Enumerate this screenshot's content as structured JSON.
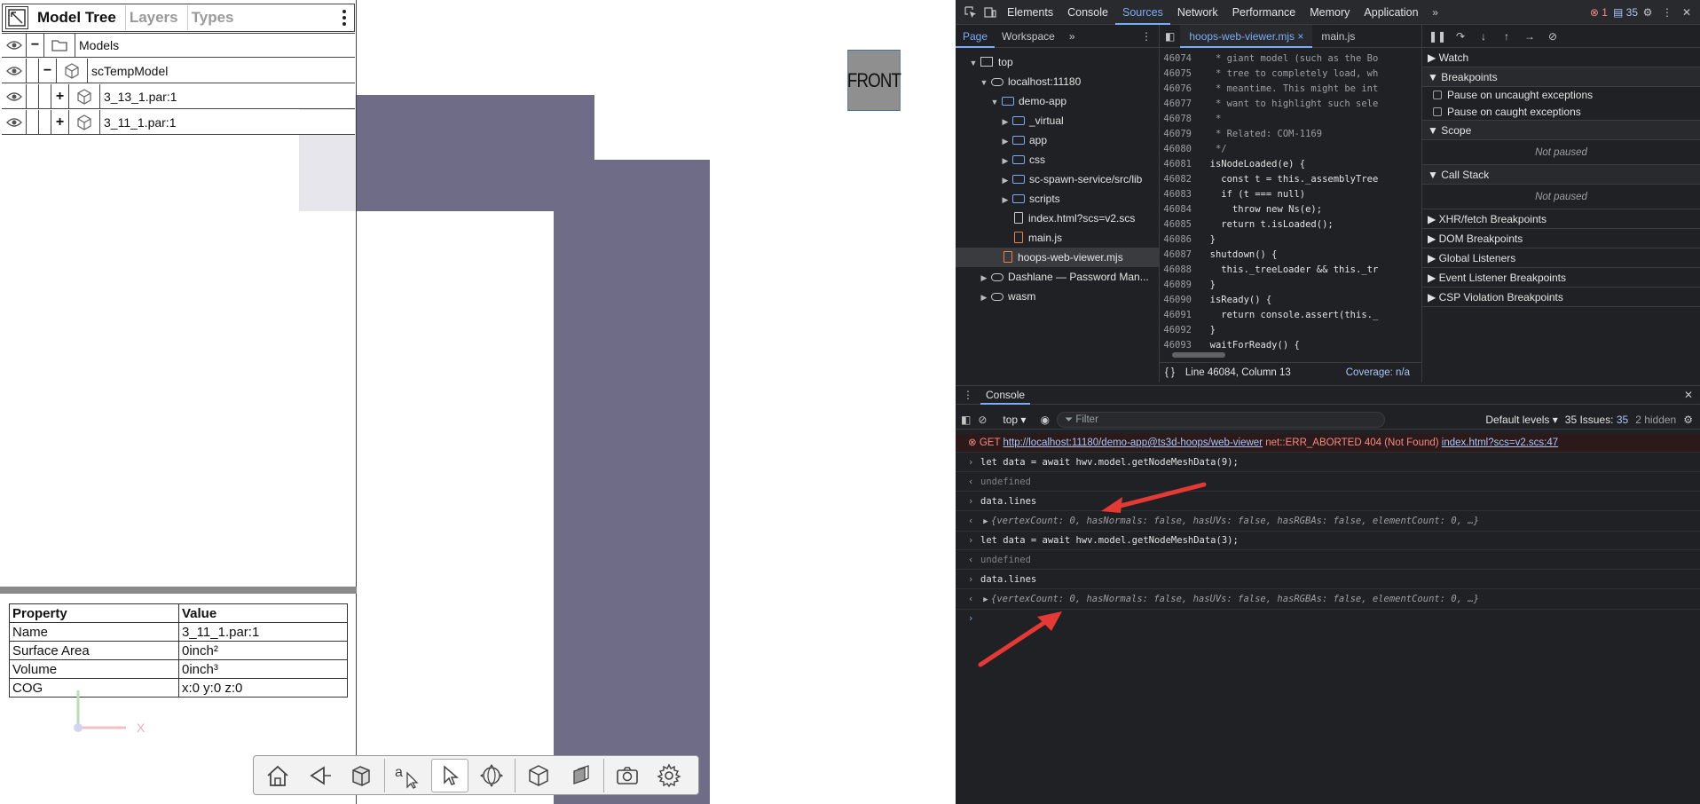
{
  "viewer": {
    "front_label": "FRONT",
    "axis_label": "X"
  },
  "tree": {
    "tabs": [
      "Model Tree",
      "Layers",
      "Types"
    ],
    "rows": [
      {
        "toggle": "−",
        "label": "Models"
      },
      {
        "toggle": "−",
        "label": "scTempModel"
      },
      {
        "toggle": "+",
        "label": "3_13_1.par:1"
      },
      {
        "toggle": "+",
        "label": "3_11_1.par:1"
      }
    ]
  },
  "properties": {
    "headers": [
      "Property",
      "Value"
    ],
    "rows": [
      [
        "Name",
        "3_11_1.par:1"
      ],
      [
        "Surface Area",
        "0inch²"
      ],
      [
        "Volume",
        "0inch³"
      ],
      [
        "COG",
        "x:0 y:0 z:0"
      ]
    ]
  },
  "devtools": {
    "tabs": [
      "Elements",
      "Console",
      "Sources",
      "Network",
      "Performance",
      "Memory",
      "Application"
    ],
    "error_count": "1",
    "info_count": "35",
    "navigator_tabs": [
      "Page",
      "Workspace"
    ],
    "tree": [
      {
        "label": "top"
      },
      {
        "label": "localhost:11180"
      },
      {
        "label": "demo-app"
      },
      {
        "label": "_virtual"
      },
      {
        "label": "app"
      },
      {
        "label": "css"
      },
      {
        "label": "sc-spawn-service/src/lib"
      },
      {
        "label": "scripts"
      },
      {
        "label": "index.html?scs=v2.scs"
      },
      {
        "label": "main.js"
      },
      {
        "label": "hoops-web-viewer.mjs"
      },
      {
        "label": "Dashlane — Password Man..."
      },
      {
        "label": "wasm"
      }
    ],
    "editor_tabs": [
      "hoops-web-viewer.mjs",
      "main.js"
    ],
    "code_lines": [
      {
        "n": "46074",
        "t": "   * giant model (such as the Bo"
      },
      {
        "n": "46075",
        "t": "   * tree to completely load, wh"
      },
      {
        "n": "46076",
        "t": "   * meantime. This might be int"
      },
      {
        "n": "46077",
        "t": "   * want to highlight such sele"
      },
      {
        "n": "46078",
        "t": "   *"
      },
      {
        "n": "46079",
        "t": "   * Related: COM-1169"
      },
      {
        "n": "46080",
        "t": "   */"
      },
      {
        "n": "46081",
        "t": "  isNodeLoaded(e) {"
      },
      {
        "n": "46082",
        "t": "    const t = this._assemblyTree"
      },
      {
        "n": "46083",
        "t": "    if (t === null)"
      },
      {
        "n": "46084",
        "t": "      throw new Ns(e);"
      },
      {
        "n": "46085",
        "t": "    return t.isLoaded();"
      },
      {
        "n": "46086",
        "t": "  }"
      },
      {
        "n": "46087",
        "t": "  shutdown() {"
      },
      {
        "n": "46088",
        "t": "    this._treeLoader && this._tr"
      },
      {
        "n": "46089",
        "t": "  }"
      },
      {
        "n": "46090",
        "t": "  isReady() {"
      },
      {
        "n": "46091",
        "t": "    return console.assert(this._"
      },
      {
        "n": "46092",
        "t": "  }"
      },
      {
        "n": "46093",
        "t": "  waitForReady() {"
      }
    ],
    "status_position": "Line 46084, Column 13",
    "status_coverage": "Coverage: n/a",
    "debugger_sections": [
      "Watch",
      "Breakpoints",
      "Scope",
      "Call Stack",
      "XHR/fetch Breakpoints",
      "DOM Breakpoints",
      "Global Listeners",
      "Event Listener Breakpoints",
      "CSP Violation Breakpoints"
    ],
    "pause_uncaught": "Pause on uncaught exceptions",
    "pause_caught": "Pause on caught exceptions",
    "not_paused": "Not paused",
    "drawer_tab": "Console",
    "console_context": "top",
    "console_filter_placeholder": "Filter",
    "default_levels": "Default levels",
    "issues": "35 Issues:",
    "issues_count": "35",
    "hidden": "2 hidden",
    "console": {
      "error_method": "GET",
      "error_url": "http://localhost:11180/demo-app@ts3d-hoops/web-viewer",
      "error_msg": "net::ERR_ABORTED 404 (Not Found)",
      "error_src": "index.html?scs=v2.scs:47",
      "cmd1": "let data = await hwv.model.getNodeMeshData(9);",
      "undef": "undefined",
      "cmd2": "data.lines",
      "result": "{vertexCount: 0, hasNormals: false, hasUVs: false, hasRGBAs: false, elementCount: 0, …}",
      "cmd3": "let data = await hwv.model.getNodeMeshData(3);"
    }
  }
}
